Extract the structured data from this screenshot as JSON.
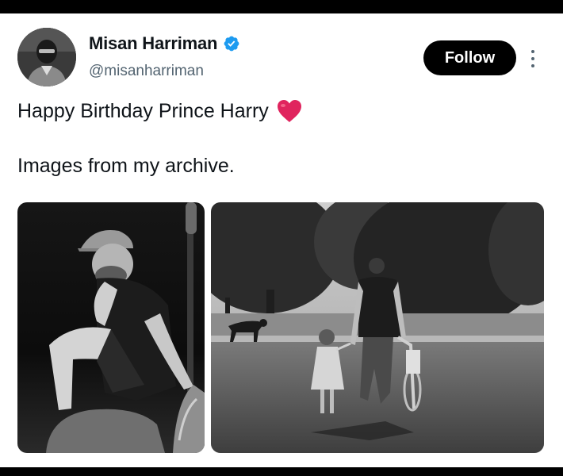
{
  "tweet": {
    "author": {
      "display_name": "Misan Harriman",
      "handle": "@misanharriman",
      "verified_icon": "verified-badge-icon",
      "avatar_icon": "avatar"
    },
    "follow_label": "Follow",
    "more_icon": "more-options-icon",
    "text_line1": "Happy Birthday Prince Harry",
    "heart_icon": "heart-emoji-icon",
    "text_line2": "Images from my archive.",
    "media": [
      {
        "name": "photo-man-seated-cap"
      },
      {
        "name": "photo-father-daughter-walking"
      }
    ]
  },
  "colors": {
    "accent_blue": "#1d9bf0",
    "text_primary": "#0f1419",
    "text_secondary": "#536471",
    "follow_bg": "#000000",
    "heart_red": "#e0245e"
  }
}
